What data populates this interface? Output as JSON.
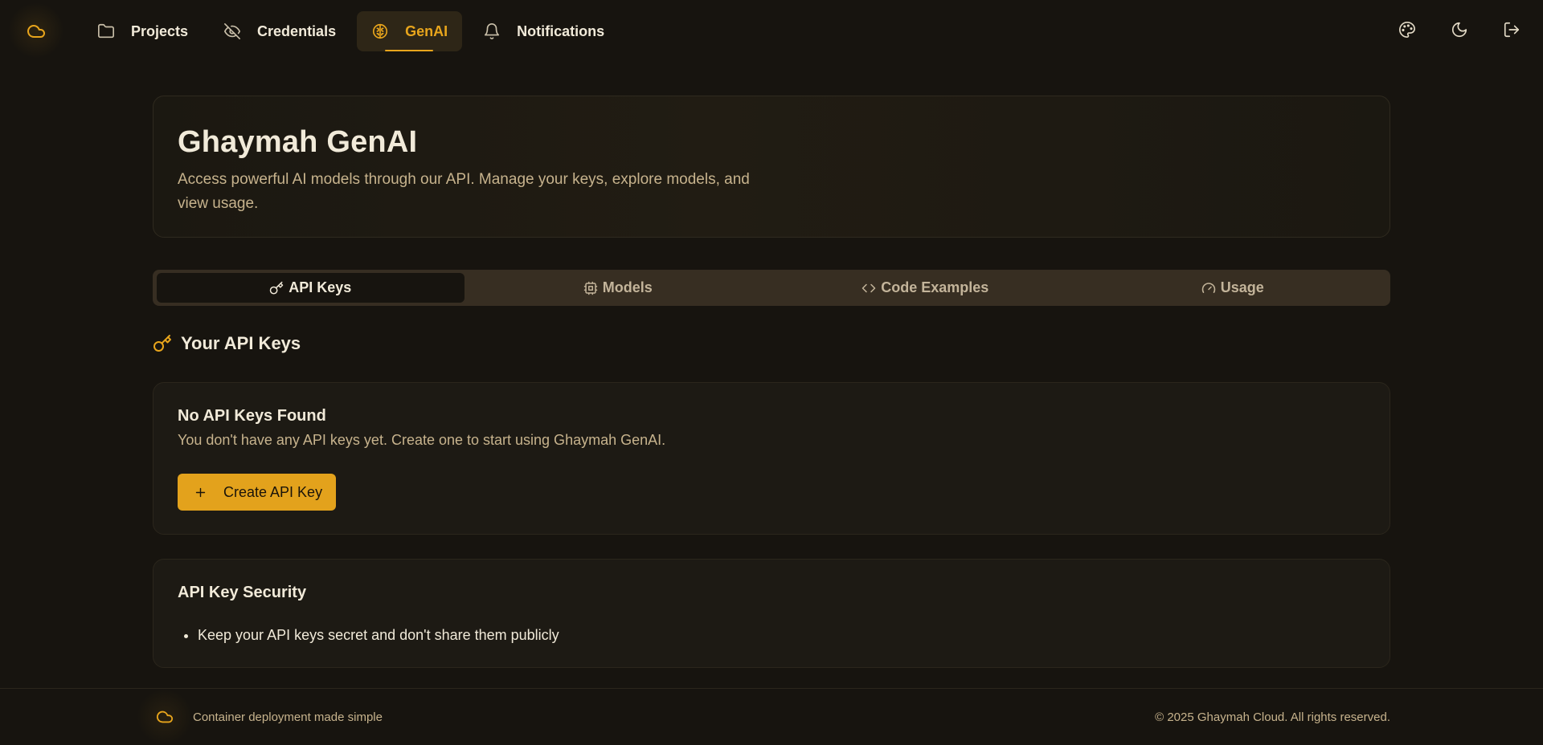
{
  "nav": {
    "logo_icon": "cloud-icon",
    "items": [
      {
        "label": "Projects",
        "icon": "folder-icon",
        "active": false
      },
      {
        "label": "Credentials",
        "icon": "eye-off-icon",
        "active": false
      },
      {
        "label": "GenAI",
        "icon": "brain-icon",
        "active": true
      },
      {
        "label": "Notifications",
        "icon": "bell-icon",
        "active": false
      }
    ],
    "right_icons": [
      "palette-icon",
      "moon-icon",
      "logout-icon"
    ]
  },
  "hero": {
    "title": "Ghaymah GenAI",
    "description": "Access powerful AI models through our API. Manage your keys, explore models, and view usage."
  },
  "tabs": [
    {
      "label": "API Keys",
      "icon": "key-icon",
      "active": true
    },
    {
      "label": "Models",
      "icon": "cpu-icon",
      "active": false
    },
    {
      "label": "Code Examples",
      "icon": "code-icon",
      "active": false
    },
    {
      "label": "Usage",
      "icon": "gauge-icon",
      "active": false
    }
  ],
  "section": {
    "title": "Your API Keys",
    "icon": "key-icon"
  },
  "empty_state": {
    "title": "No API Keys Found",
    "message": "You don't have any API keys yet. Create one to start using Ghaymah GenAI.",
    "button_label": "Create API Key",
    "button_icon": "plus-icon"
  },
  "security": {
    "title": "API Key Security",
    "tips": [
      "Keep your API keys secret and don't share them publicly"
    ]
  },
  "footer": {
    "tagline": "Container deployment made simple",
    "copyright": "© 2025 Ghaymah Cloud. All rights reserved."
  },
  "colors": {
    "background": "#17140f",
    "accent": "#e8a51c",
    "card": "#1d1a14",
    "tab_bar": "#372e22",
    "muted_text": "#c7b38d"
  }
}
